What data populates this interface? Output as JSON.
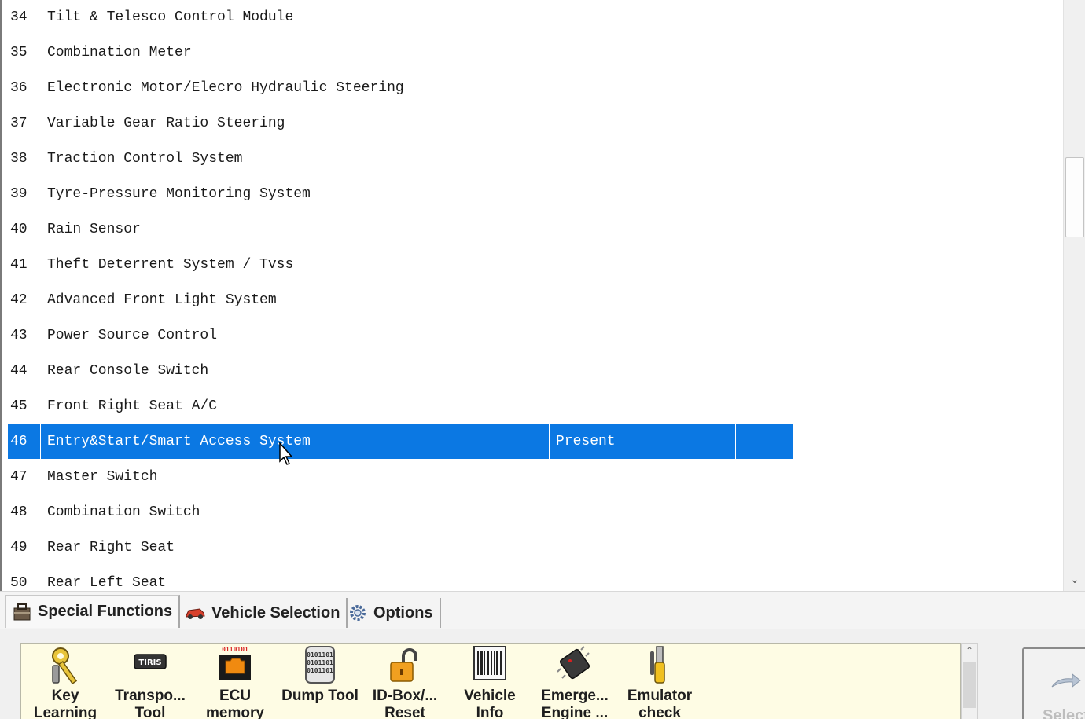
{
  "list": {
    "rows": [
      {
        "num": "34",
        "name": "Tilt & Telesco Control Module",
        "status": ""
      },
      {
        "num": "35",
        "name": "Combination Meter",
        "status": ""
      },
      {
        "num": "36",
        "name": "Electronic Motor/Elecro Hydraulic Steering",
        "status": ""
      },
      {
        "num": "37",
        "name": "Variable Gear Ratio Steering",
        "status": ""
      },
      {
        "num": "38",
        "name": "Traction Control System",
        "status": ""
      },
      {
        "num": "39",
        "name": "Tyre-Pressure Monitoring System",
        "status": ""
      },
      {
        "num": "40",
        "name": "Rain Sensor",
        "status": ""
      },
      {
        "num": "41",
        "name": "Theft Deterrent System / Tvss",
        "status": ""
      },
      {
        "num": "42",
        "name": "Advanced Front Light System",
        "status": ""
      },
      {
        "num": "43",
        "name": "Power Source Control",
        "status": ""
      },
      {
        "num": "44",
        "name": "Rear Console Switch",
        "status": ""
      },
      {
        "num": "45",
        "name": "Front Right Seat A/C",
        "status": ""
      },
      {
        "num": "46",
        "name": "Entry&Start/Smart Access System",
        "status": "Present"
      },
      {
        "num": "47",
        "name": "Master Switch",
        "status": ""
      },
      {
        "num": "48",
        "name": "Combination Switch",
        "status": ""
      },
      {
        "num": "49",
        "name": "Rear Right Seat",
        "status": ""
      },
      {
        "num": "50",
        "name": "Rear Left Seat",
        "status": ""
      }
    ],
    "selected_num": "46",
    "selection_color": "#0b78e3"
  },
  "tabs": [
    {
      "label": "Special Functions",
      "icon": "toolbox-icon",
      "active": true
    },
    {
      "label": "Vehicle Selection",
      "icon": "car-icon",
      "active": false
    },
    {
      "label": "Options",
      "icon": "gear-icon",
      "active": false
    }
  ],
  "tools": [
    {
      "line1": "Key",
      "line2": "Learning",
      "icon": "key-icon"
    },
    {
      "line1": "Transpo...",
      "line2": "Tool",
      "icon": "transponder-icon",
      "badge": "TIRIS"
    },
    {
      "line1": "ECU",
      "line2": "memory",
      "icon": "ecu-icon",
      "badge": "0110101"
    },
    {
      "line1": "Dump Tool",
      "line2": "",
      "icon": "binary-doc-icon",
      "badge": "0101101"
    },
    {
      "line1": "ID-Box/...",
      "line2": "Reset",
      "icon": "padlock-icon"
    },
    {
      "line1": "Vehicle",
      "line2": "Info",
      "icon": "barcode-icon"
    },
    {
      "line1": "Emerge...",
      "line2": "Engine ...",
      "icon": "chip-icon"
    },
    {
      "line1": "Emulator",
      "line2": "check",
      "icon": "screwdriver-icon"
    }
  ],
  "select_button": {
    "label": "Select"
  }
}
